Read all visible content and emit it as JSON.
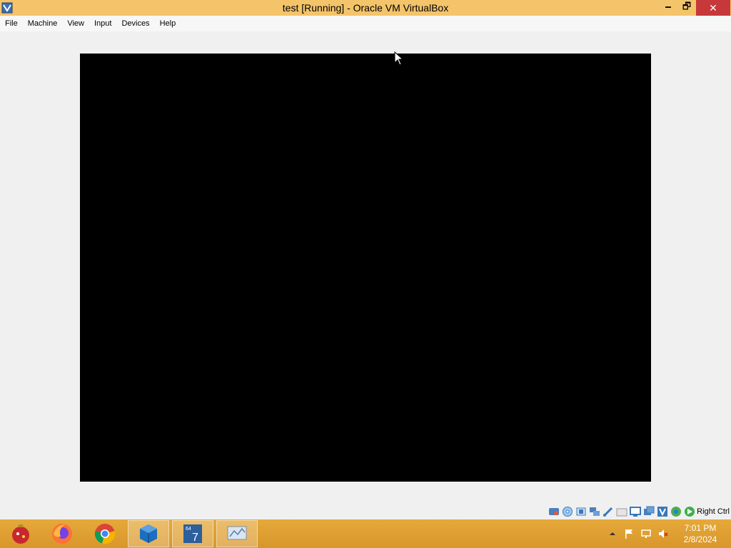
{
  "window": {
    "title": "test [Running] - Oracle VM VirtualBox",
    "minimize_glyph": "🗕",
    "maximize_glyph": "🗗",
    "close_glyph": "✕"
  },
  "menubar": {
    "items": [
      {
        "label": "File"
      },
      {
        "label": "Machine"
      },
      {
        "label": "View"
      },
      {
        "label": "Input"
      },
      {
        "label": "Devices"
      },
      {
        "label": "Help"
      }
    ]
  },
  "vm": {
    "screen_color": "#000000"
  },
  "statusbar": {
    "icons": [
      "hard-disk-icon",
      "optical-drive-icon",
      "audio-icon",
      "network-icon",
      "usb-icon",
      "shared-folders-icon",
      "display-icon",
      "video-capture-icon",
      "processor-icon",
      "virtualization-icon",
      "mouse-integration-icon",
      "keyboard-icon"
    ],
    "host_key": "Right Ctrl"
  },
  "taskbar": {
    "apps": [
      {
        "name": "ornament-app-icon"
      },
      {
        "name": "firefox-icon"
      },
      {
        "name": "chrome-icon"
      },
      {
        "name": "virtualbox-icon"
      },
      {
        "name": "windows7-vm-icon"
      },
      {
        "name": "resource-monitor-icon"
      }
    ],
    "clock": {
      "time": "7:01 PM",
      "date": "2/8/2024"
    }
  },
  "colors": {
    "titlebar": "#f4c46a",
    "taskbar": "#e0a033",
    "close_button": "#c7383a"
  }
}
